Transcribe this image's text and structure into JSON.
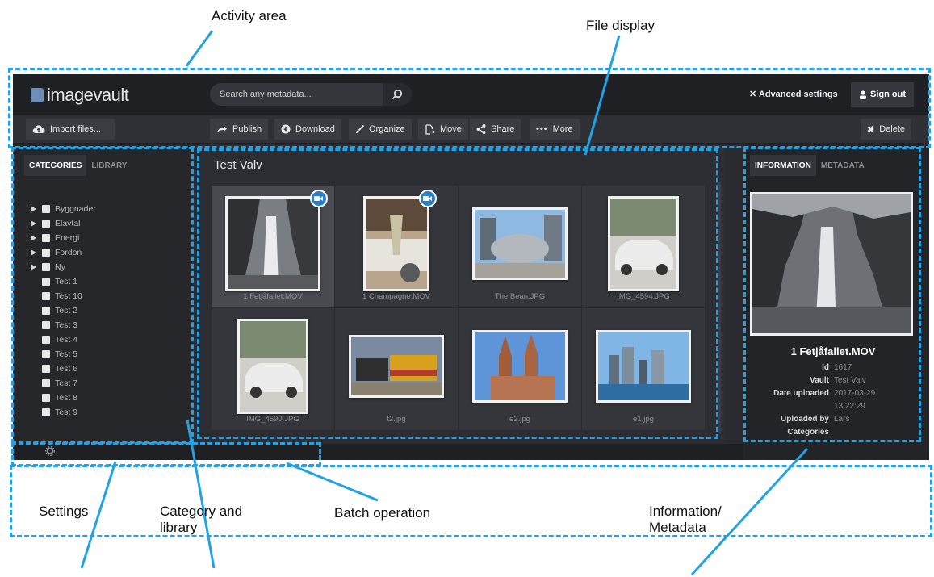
{
  "annotations": {
    "activity_area": "Activity area",
    "file_display": "File display",
    "settings": "Settings",
    "category_library": "Category and library",
    "batch_operation": "Batch operation",
    "information_metadata": "Information/ Metadata",
    "accent_color": "#1fa3e6"
  },
  "header": {
    "logo": "imagevault",
    "search_placeholder": "Search any metadata...",
    "advanced_settings": "Advanced settings",
    "sign_out": "Sign out"
  },
  "toolbar": {
    "import": "Import files...",
    "publish": "Publish",
    "download": "Download",
    "organize": "Organize",
    "move": "Move",
    "share": "Share",
    "more": "More",
    "delete": "Delete"
  },
  "left_panel": {
    "tabs": [
      "CATEGORIES",
      "LIBRARY"
    ],
    "active_tab": "CATEGORIES",
    "categories": [
      {
        "label": "Byggnader",
        "expandable": true
      },
      {
        "label": "Elavtal",
        "expandable": true
      },
      {
        "label": "Energi",
        "expandable": true
      },
      {
        "label": "Fordon",
        "expandable": true
      },
      {
        "label": "Ny",
        "expandable": true
      },
      {
        "label": "Test 1",
        "expandable": false
      },
      {
        "label": "Test 10",
        "expandable": false
      },
      {
        "label": "Test 2",
        "expandable": false
      },
      {
        "label": "Test 3",
        "expandable": false
      },
      {
        "label": "Test 4",
        "expandable": false
      },
      {
        "label": "Test 5",
        "expandable": false
      },
      {
        "label": "Test 6",
        "expandable": false
      },
      {
        "label": "Test 7",
        "expandable": false
      },
      {
        "label": "Test 8",
        "expandable": false
      },
      {
        "label": "Test 9",
        "expandable": false
      }
    ]
  },
  "main": {
    "folder_title": "Test Valv",
    "files": [
      {
        "name": "1 Fetjåfallet.MOV",
        "selected": true,
        "video": true,
        "icon": "waterfall"
      },
      {
        "name": "1 Champagne.MOV",
        "selected": false,
        "video": true,
        "icon": "champagne"
      },
      {
        "name": "The Bean.JPG",
        "selected": false,
        "video": false,
        "icon": "bean"
      },
      {
        "name": "IMG_4594.JPG",
        "selected": false,
        "video": false,
        "icon": "car"
      },
      {
        "name": "IMG_4590.JPG",
        "selected": false,
        "video": false,
        "icon": "car"
      },
      {
        "name": "t2.jpg",
        "selected": false,
        "video": false,
        "icon": "train"
      },
      {
        "name": "e2.jpg",
        "selected": false,
        "video": false,
        "icon": "church"
      },
      {
        "name": "e1.jpg",
        "selected": false,
        "video": false,
        "icon": "city"
      }
    ]
  },
  "right_panel": {
    "tabs": [
      "INFORMATION",
      "METADATA"
    ],
    "active_tab": "INFORMATION",
    "file_name": "1 Fetjåfallet.MOV",
    "fields": [
      {
        "key": "Id",
        "value": "1617"
      },
      {
        "key": "Vault",
        "value": "Test Valv"
      },
      {
        "key": "Date uploaded",
        "value": "2017-03-29"
      },
      {
        "key": "",
        "value": "13:22:29"
      },
      {
        "key": "Uploaded by",
        "value": "Lars"
      },
      {
        "key": "Categories",
        "value": ""
      }
    ]
  }
}
